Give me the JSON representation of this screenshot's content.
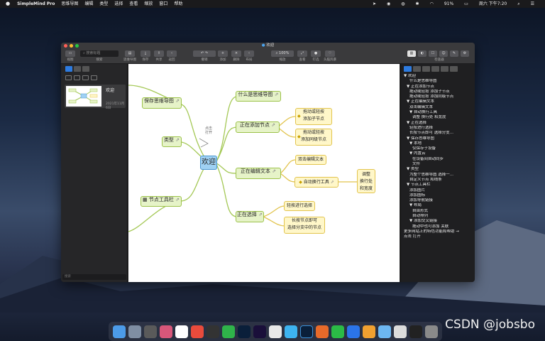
{
  "menubar": {
    "apple": "",
    "app_name": "SimpleMind Pro",
    "items": [
      "思维导图",
      "编辑",
      "类型",
      "选择",
      "查看",
      "缩放",
      "窗口",
      "帮助"
    ],
    "battery": "91%",
    "clock": "周六 下午7:20"
  },
  "window": {
    "title": "欢迎",
    "toolbar": {
      "search_placeholder": "搜索标题",
      "labels": [
        "视图",
        "搜索",
        "思维导图",
        "保存",
        "共享",
        "返回",
        "撤销",
        "添加",
        "删除",
        "布局",
        "缩放",
        "查看",
        "钉选",
        "头脑风暴",
        "检查器"
      ],
      "zoom": "100%"
    },
    "left_panel": {
      "doc_name": "欢迎",
      "doc_date": "2021年11月6日",
      "search_placeholder": "搜索"
    },
    "mindmap": {
      "center": "欢迎",
      "nodes": {
        "save": "保存思维导图",
        "type": "类型",
        "toolbar": "节点工具栏",
        "what": "什么是思维导图",
        "adding": "正在添加节点",
        "add_child": [
          "拖动或轻按",
          "添加子节点"
        ],
        "add_sibling": [
          "拖动或轻按",
          "添加同级节点"
        ],
        "editing": "正在编辑文本",
        "dbl_click": "双击编辑文本",
        "auto_tool": "自动换行工具",
        "adjust": [
          "调整",
          "换行处",
          "和宽度"
        ],
        "selecting": "正在选择",
        "tap_select": "轻按进行选择",
        "long_press": [
          "长按节点即可",
          "选择分支中的节点"
        ],
        "click_open": [
          "点击",
          "打开"
        ]
      }
    },
    "outline": {
      "items": [
        "▼ 欢迎",
        "什么是思维导图",
        "▼ 正在添加节点",
        "拖动或轻按 添加子节点",
        "拖动或轻按 添加同级节点",
        "▼ 正在编辑文本",
        "双击编辑文本",
        "▼ 自动换行工具",
        "调整 换行处 和宽度",
        "▼ 正在选择",
        "轻按进行选择",
        "长按节点即可 选择分支...",
        "▼ 保存思维导图",
        "▼ 本地",
        "仅保存于设备",
        "▼ 内置云",
        "在设备间自动同步",
        "文件",
        "▼ 类型",
        "为整个思维导图 选择一...",
        "自定义节点 和线条",
        "▼ 节点工具栏",
        "添加图片",
        "添加图标",
        "添加导航链接",
        "▼ 布局",
        "自由形式",
        "自动排列",
        "▼ 添加交叉链接",
        "拖动中也可添加 关联",
        "更多网站上的特色功能和帮助 →",
        "点击 打开"
      ]
    }
  },
  "watermark": "CSDN @jobsbo",
  "colors": {
    "node_green": "#e6f3c8",
    "node_yellow": "#fff7c9",
    "center_blue": "#9fd1f3",
    "accent": "#2d7be0"
  }
}
